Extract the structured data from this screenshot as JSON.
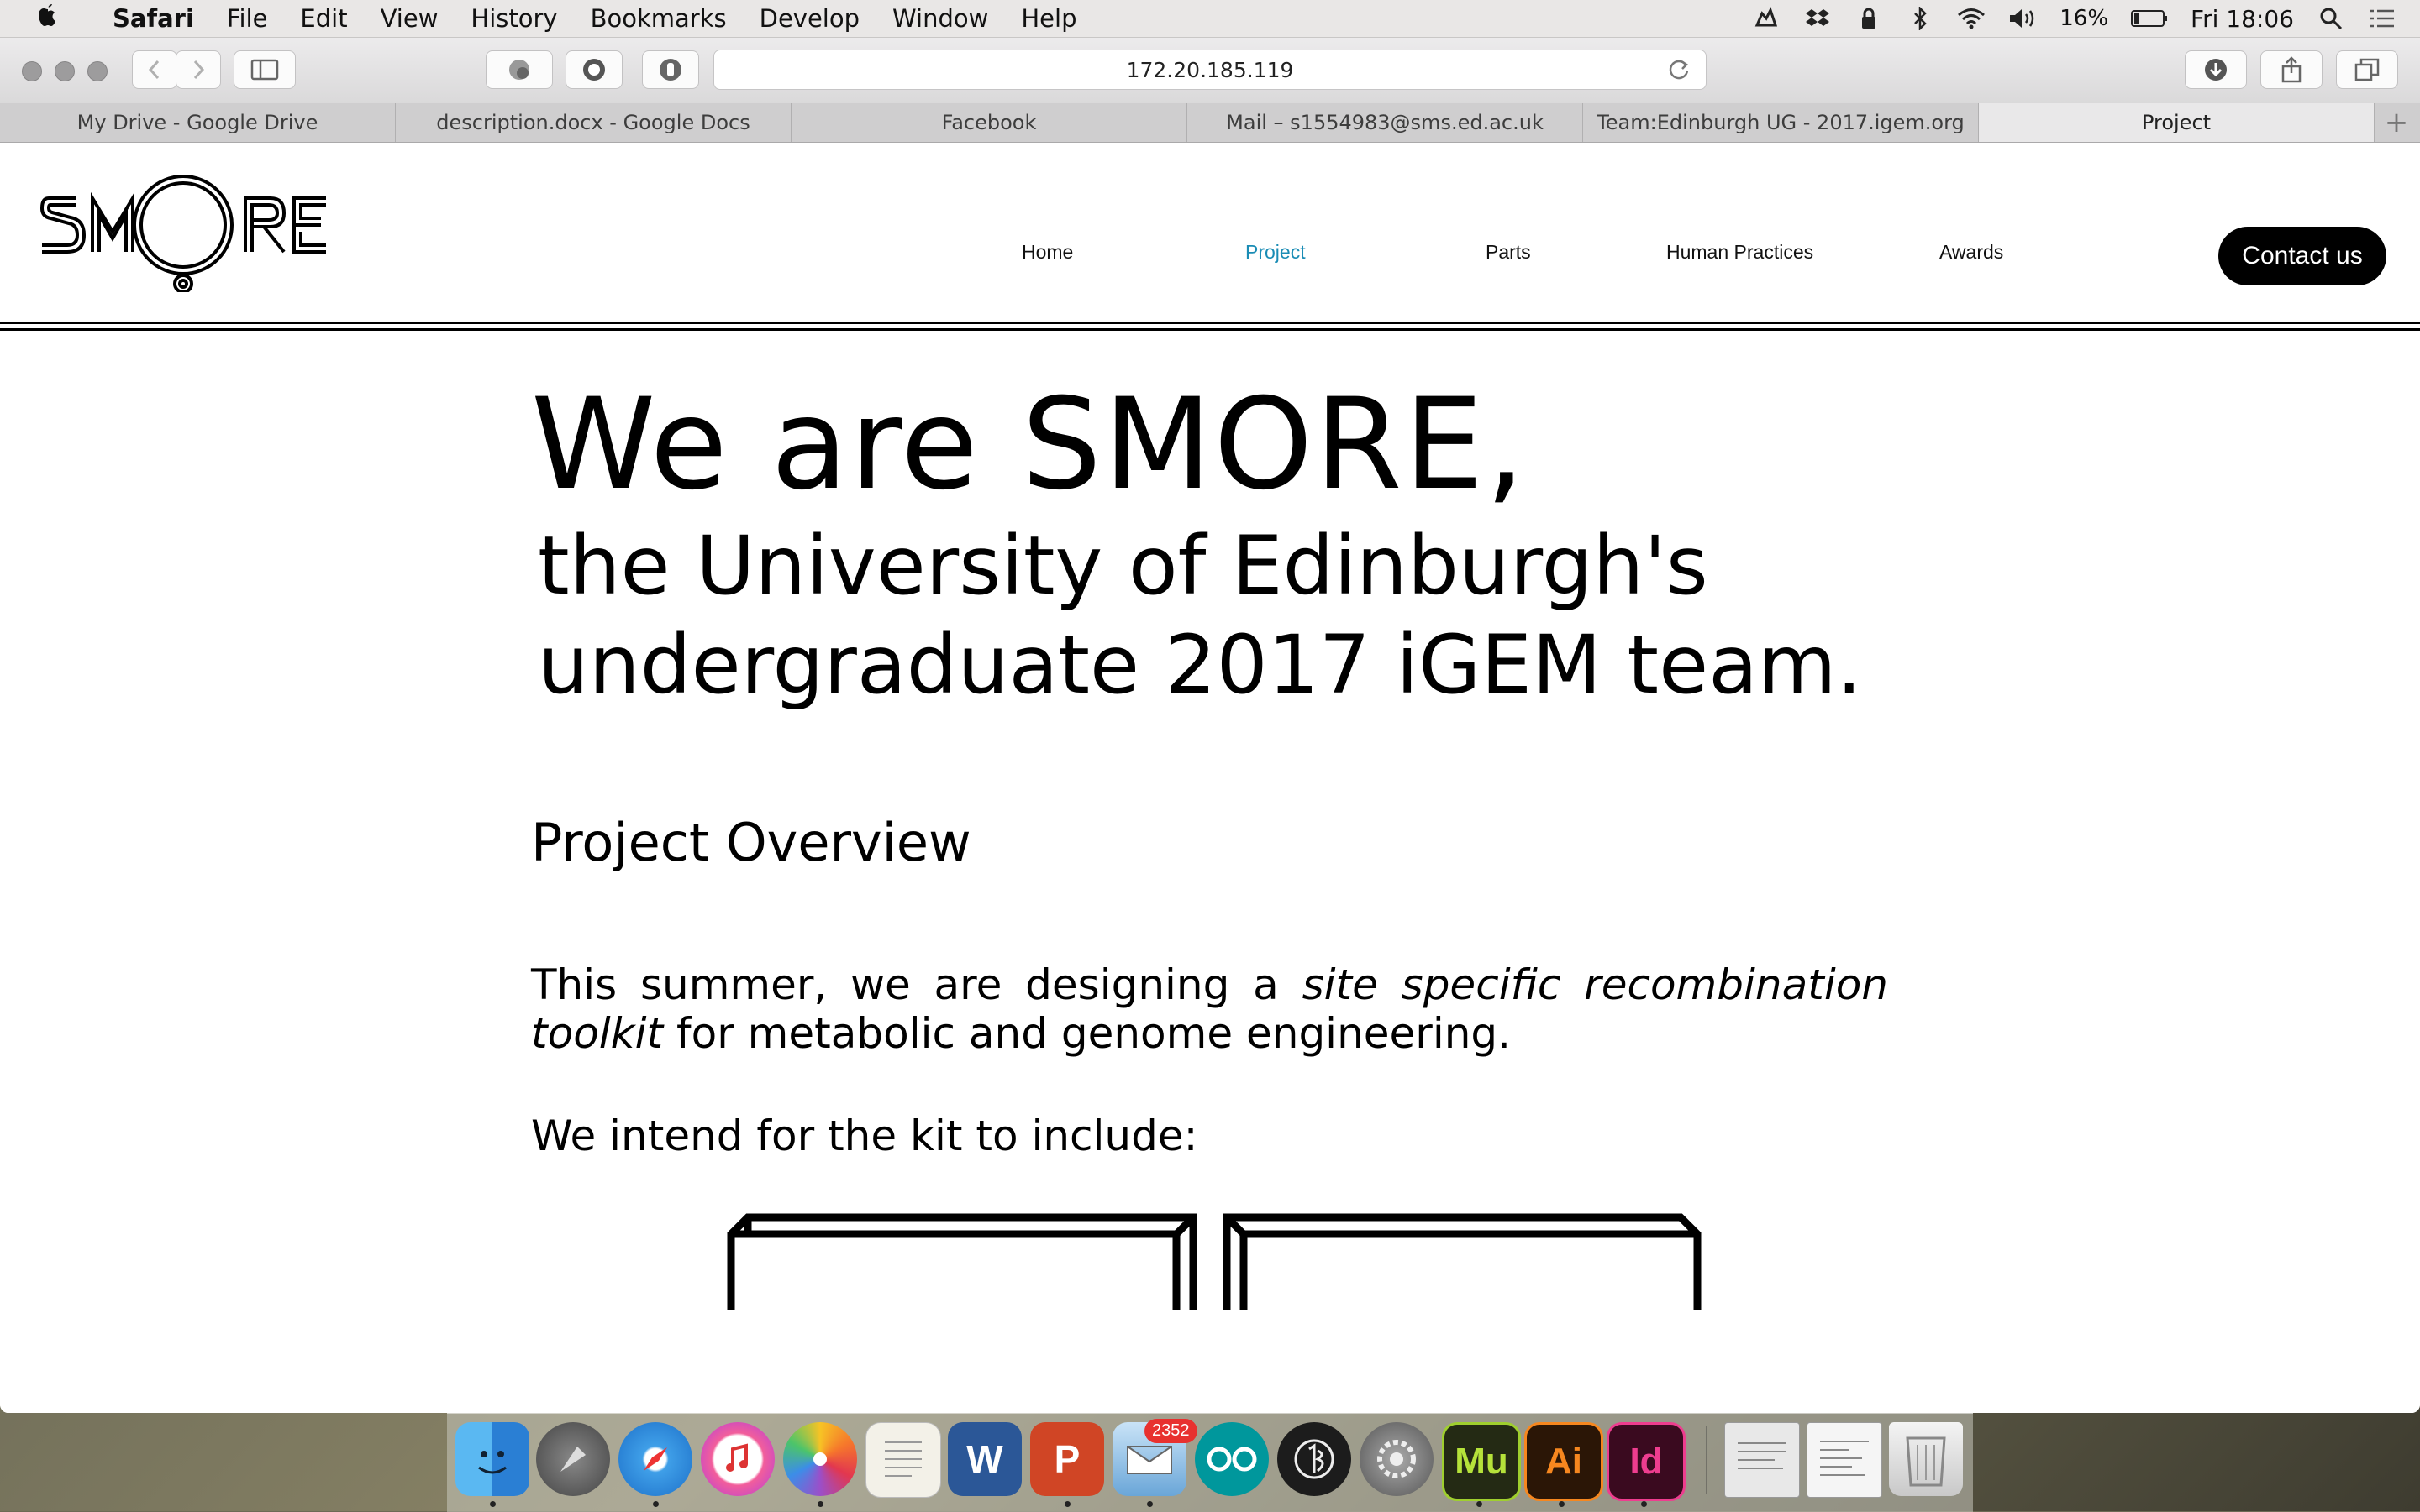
{
  "menubar": {
    "apple": "",
    "app": "Safari",
    "items": [
      "File",
      "Edit",
      "View",
      "History",
      "Bookmarks",
      "Develop",
      "Window",
      "Help"
    ],
    "battery": "16%",
    "clock": "Fri 18:06"
  },
  "browser": {
    "url": "172.20.185.119",
    "tabs": [
      {
        "label": "My Drive - Google Drive"
      },
      {
        "label": "description.docx - Google Docs"
      },
      {
        "label": "Facebook"
      },
      {
        "label": "Mail – s1554983@sms.ed.ac.uk"
      },
      {
        "label": "Team:Edinburgh UG - 2017.igem.org"
      },
      {
        "label": "Project"
      }
    ],
    "new_tab": "+"
  },
  "site": {
    "logo_text": "SMORE",
    "nav": [
      "Home",
      "Project",
      "Parts",
      "Human Practices",
      "Awards"
    ],
    "contact": "Contact us",
    "accent": "#1a8cb5",
    "hero_title": "We are SMORE,",
    "hero_line1": "the University of Edinburgh's",
    "hero_line2": "undergraduate 2017 iGEM team.",
    "section_title": "Project Overview",
    "para_a": "This summer, we are designing a ",
    "para_em": "site specific recombination toolkit",
    "para_b": " for metabolic and genome engineering.",
    "para2": "We intend for the kit to include:"
  },
  "dock": {
    "apps": [
      "finder",
      "launchpad",
      "safari",
      "itunes",
      "photos",
      "textedit",
      "word",
      "powerpoint",
      "mail",
      "arduino",
      "sibelius",
      "system-preferences",
      "muse",
      "illustrator",
      "indesign"
    ],
    "mail_badge": "2352",
    "muse_label": "Mu",
    "illustrator_label": "Ai",
    "indesign_label": "Id",
    "word_label": "W",
    "powerpoint_label": "P"
  }
}
